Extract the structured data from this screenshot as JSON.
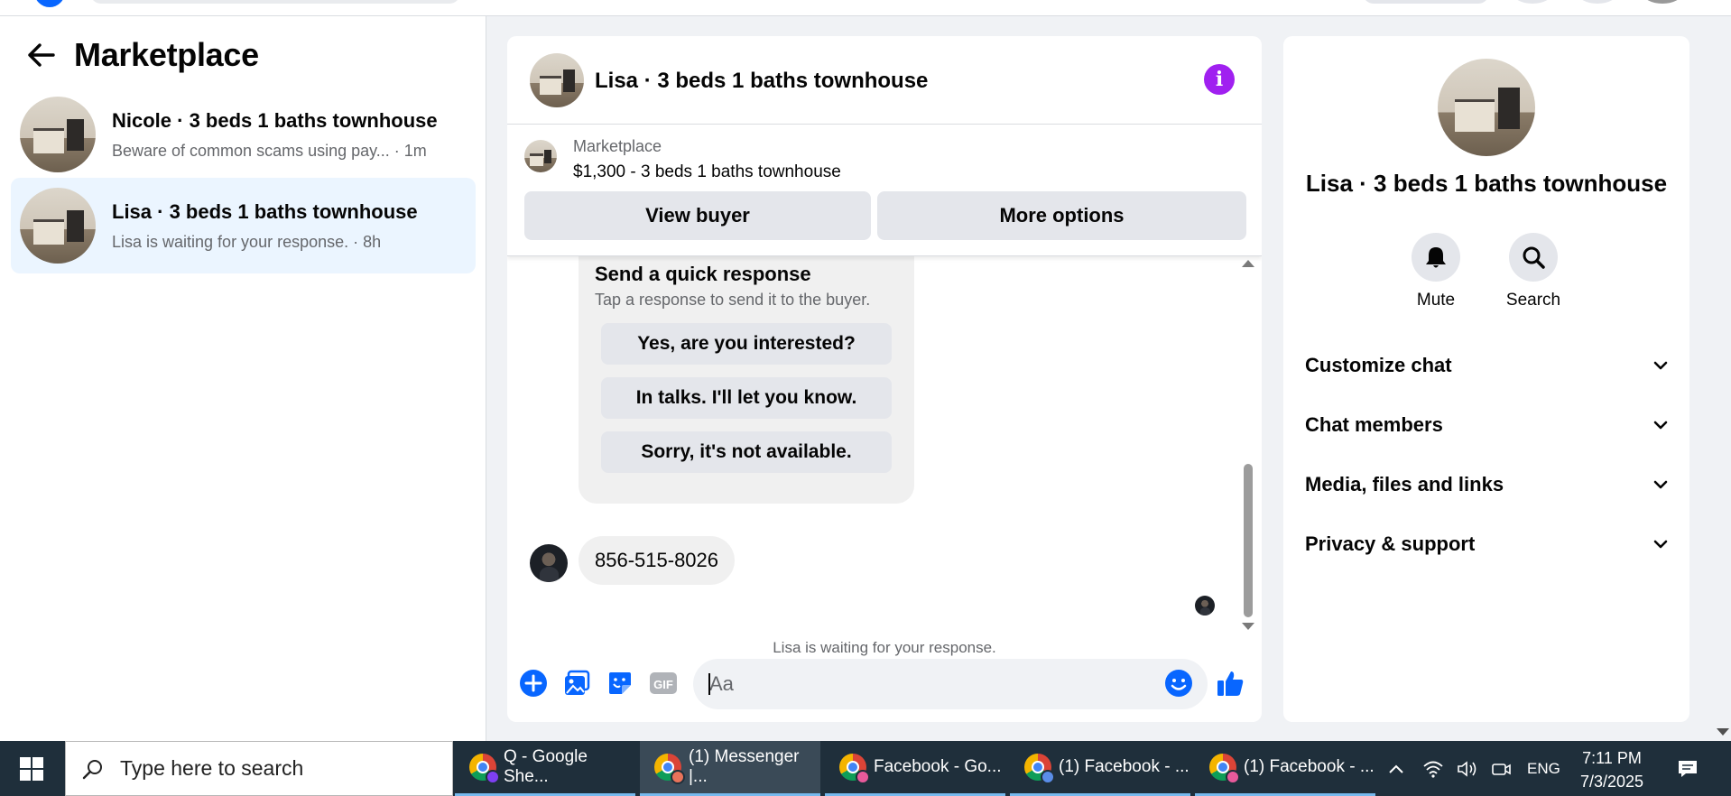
{
  "sidebar": {
    "title": "Marketplace",
    "conversations": [
      {
        "name": "Nicole · 3 beds 1 baths townhouse",
        "snippet": "Beware of common scams using pay... · 1m"
      },
      {
        "name": "Lisa · 3 beds 1 baths townhouse",
        "snippet": "Lisa is waiting for your response. · 8h"
      }
    ]
  },
  "chat": {
    "title": "Lisa · 3 beds 1 baths townhouse",
    "listing": {
      "category": "Marketplace",
      "price_title": "$1,300 - 3 beds 1 baths townhouse",
      "view_buyer": "View buyer",
      "more_options": "More options"
    },
    "quick_response": {
      "title": "Send a quick response",
      "subtitle": "Tap a response to send it to the buyer.",
      "options": [
        "Yes, are you interested?",
        "In talks. I'll let you know.",
        "Sorry, it's not available."
      ]
    },
    "phone_message": "856-515-8026",
    "status": "Lisa is waiting for your response.",
    "composer_placeholder": "Aa"
  },
  "info_panel": {
    "name": "Lisa · 3 beds 1 baths townhouse",
    "actions": [
      "Mute",
      "Search"
    ],
    "sections": [
      "Customize chat",
      "Chat members",
      "Media, files and links",
      "Privacy & support"
    ]
  },
  "taskbar": {
    "search_placeholder": "Type here to search",
    "apps": [
      "Q - Google She...",
      "(1) Messenger |...",
      "Facebook - Go...",
      "(1) Facebook - ...",
      "(1) Facebook - ..."
    ],
    "language": "ENG",
    "time": "7:11 PM",
    "date": "7/3/2025"
  },
  "colors": {
    "accent": "#0866ff",
    "info": "#a020f0",
    "active_conv": "#ebf5ff"
  }
}
